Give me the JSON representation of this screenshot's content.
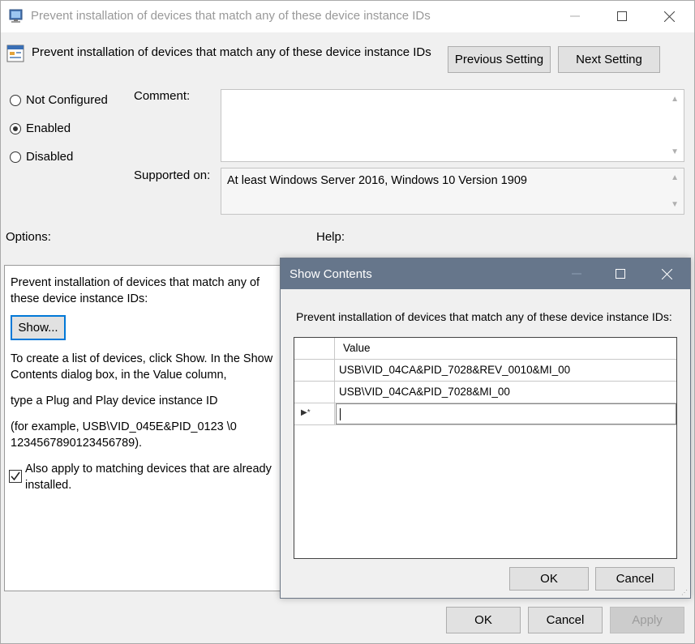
{
  "window": {
    "title": "Prevent installation of devices that match any of these device instance IDs",
    "controls": [
      "minimize",
      "maximize",
      "close"
    ]
  },
  "header": {
    "policy_name": "Prevent installation of devices that match any of these device instance IDs",
    "previous_label": "Previous Setting",
    "next_label": "Next Setting"
  },
  "state": {
    "options": [
      {
        "label": "Not Configured",
        "selected": false
      },
      {
        "label": "Enabled",
        "selected": true
      },
      {
        "label": "Disabled",
        "selected": false
      }
    ]
  },
  "comment": {
    "label": "Comment:",
    "value": ""
  },
  "supported": {
    "label": "Supported on:",
    "value": "At least Windows Server 2016, Windows 10 Version 1909"
  },
  "sections": {
    "options_label": "Options:",
    "help_label": "Help:"
  },
  "options_panel": {
    "intro": "Prevent installation of devices that match any of these device instance IDs:",
    "show_label": "Show...",
    "help_line1": "To create a list of devices, click Show. In the Show Contents dialog box, in the Value column,",
    "help_line2": "type a Plug and Play device instance ID",
    "help_line3": "(for example, USB\\VID_045E&PID_0123 \\0123456789012345678­9).",
    "checkbox_label": "Also apply to matching devices that are already installed.",
    "checkbox_checked": true
  },
  "dialog": {
    "title": "Show Contents",
    "prompt": "Prevent installation of devices that match any of these device instance IDs:",
    "column_header": "Value",
    "rows": [
      "USB\\VID_04CA&PID_7028&REV_0010&MI_00",
      "USB\\VID_04CA&PID_7028&MI_00"
    ],
    "new_row_marker": "▶*",
    "ok_label": "OK",
    "cancel_label": "Cancel"
  },
  "footer": {
    "ok_label": "OK",
    "cancel_label": "Cancel",
    "apply_label": "Apply"
  }
}
